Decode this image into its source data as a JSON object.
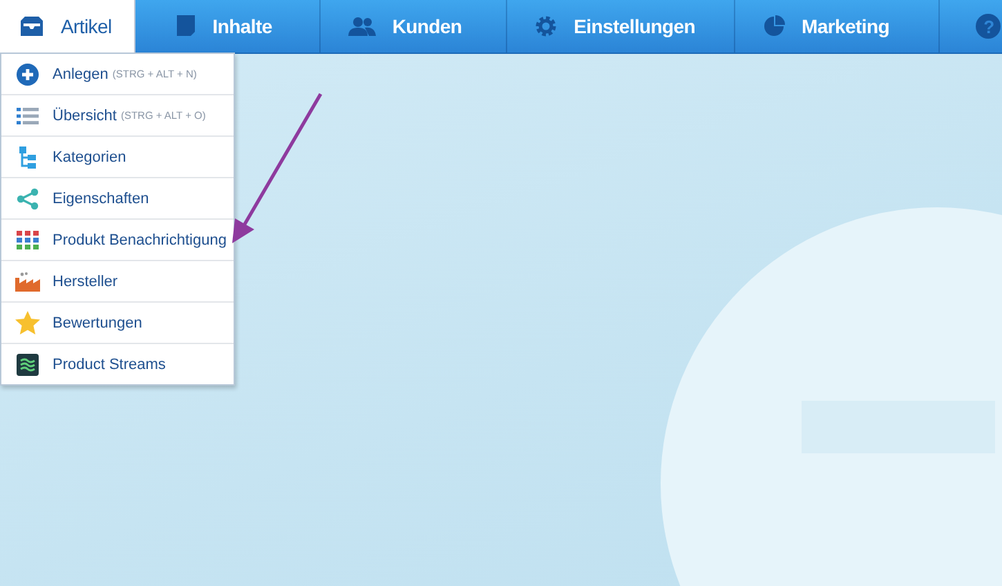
{
  "nav": {
    "tabs": [
      {
        "kind": "text",
        "label": "Artikel",
        "selected": true
      },
      {
        "kind": "text",
        "label": "Inhalte",
        "selected": false
      },
      {
        "kind": "text",
        "label": "Kunden",
        "selected": false
      },
      {
        "kind": "text",
        "label": "Einstellungen",
        "selected": false
      },
      {
        "kind": "text",
        "label": "Marketing",
        "selected": false
      },
      {
        "kind": "help",
        "label": "?",
        "selected": false
      }
    ]
  },
  "menu": {
    "items": [
      {
        "label": "Anlegen",
        "shortcut": "(STRG + ALT + N)"
      },
      {
        "label": "Übersicht",
        "shortcut": "(STRG + ALT + O)"
      },
      {
        "label": "Kategorien"
      },
      {
        "label": "Eigenschaften"
      },
      {
        "label": "Produkt Benachrichtigung"
      },
      {
        "label": "Hersteller"
      },
      {
        "label": "Bewertungen"
      },
      {
        "label": "Product Streams"
      }
    ]
  }
}
